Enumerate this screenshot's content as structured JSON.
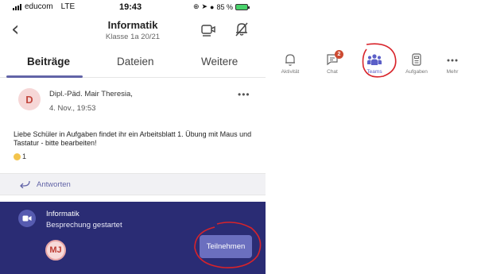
{
  "status_bar": {
    "carrier": "educom",
    "network": "LTE",
    "time": "19:43",
    "battery": "85 %"
  },
  "header": {
    "title": "Informatik",
    "subtitle": "Klasse 1a 20/21",
    "icons": [
      "back-icon",
      "video-call-icon",
      "notifications-off-icon"
    ]
  },
  "tabs": [
    {
      "label": "Beiträge",
      "active": true
    },
    {
      "label": "Dateien",
      "active": false
    },
    {
      "label": "Weitere",
      "active": false
    }
  ],
  "post": {
    "avatar_initial": "D",
    "author": "Dipl.-Päd. Mair Theresia,",
    "time": "4. Nov., 19:53",
    "message": "Liebe Schüler in Aufgaben findet ihr ein Arbeitsblatt 1. Übung mit Maus und Tastatur - bitte bearbeiten!",
    "reaction_count": "1",
    "more_label": "•••"
  },
  "reply": {
    "label": "Antworten"
  },
  "meeting": {
    "title": "Informatik",
    "status": "Besprechung gestartet",
    "participant_initials": "MJ",
    "join_label": "Teilnehmen"
  },
  "bottom_nav": [
    {
      "label": "Aktivität",
      "icon": "bell-icon",
      "active": false
    },
    {
      "label": "Chat",
      "icon": "chat-icon",
      "badge": "2",
      "active": false
    },
    {
      "label": "Teams",
      "icon": "teams-icon",
      "active": true
    },
    {
      "label": "Aufgaben",
      "icon": "assignments-icon",
      "active": false
    },
    {
      "label": "Mehr",
      "icon": "more-icon",
      "active": false
    }
  ],
  "colors": {
    "accent": "#6264a7",
    "meeting_bg": "#2a2c74",
    "annotation": "#d8232a"
  }
}
